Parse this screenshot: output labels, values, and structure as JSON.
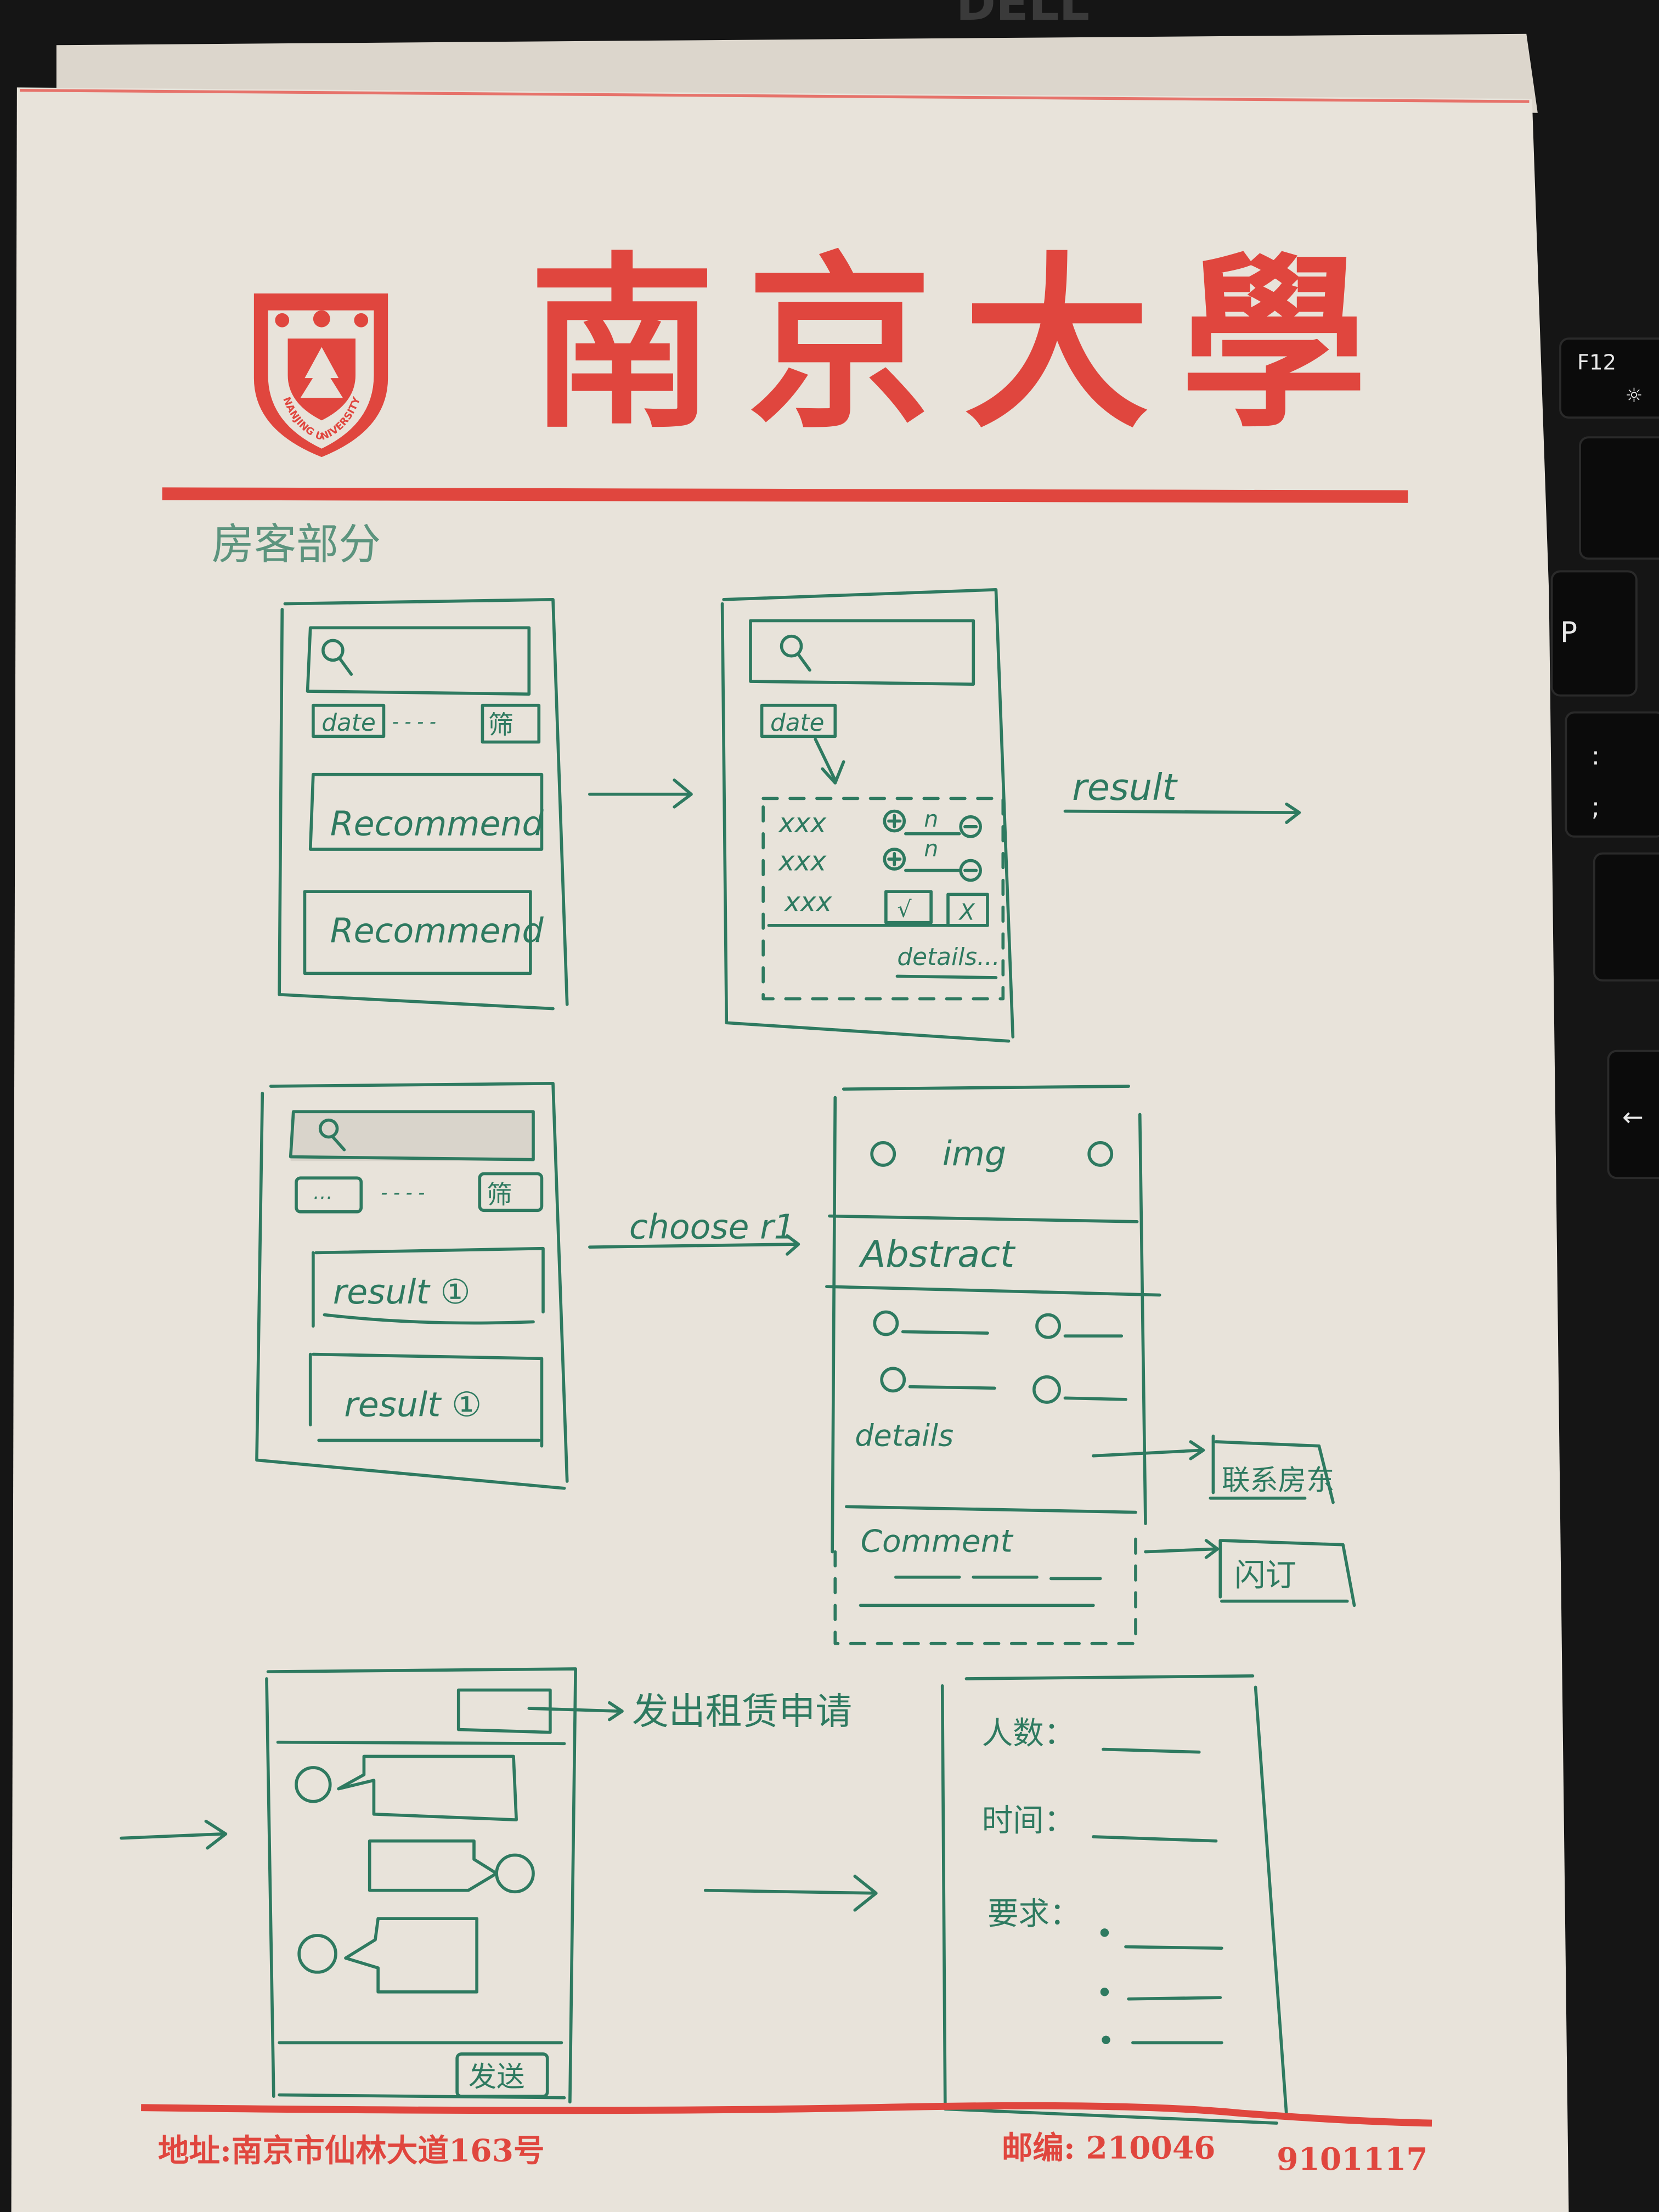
{
  "laptop": {
    "logo": "DELL",
    "keys": [
      "F12",
      "P",
      ":",
      ";",
      "←"
    ]
  },
  "letterhead": {
    "university_name": "南京大學",
    "emblem_text": "NANJING UNIVERSITY",
    "address": "地址:南京市仙林大道163号",
    "postcode": "邮编: 210046",
    "code": "9101117",
    "accent_color": "#e0463e"
  },
  "sketch": {
    "ink_color": "#2e7a60",
    "section_label": "房客部分",
    "screen_home": {
      "search_icon": "magnifier-icon",
      "date_chip": "date",
      "chip_dots": "- - - -",
      "filter_chip": "筛",
      "cards": [
        "Recommend",
        "Recommend"
      ]
    },
    "screen_filter": {
      "search_icon": "magnifier-icon",
      "date_chip": "date",
      "rows": [
        {
          "label": "xxx",
          "value": "n",
          "control": "stepper"
        },
        {
          "label": "xxx",
          "value": "n",
          "control": "stepper"
        },
        {
          "label": "xxx",
          "control": "confirm-cancel",
          "confirm": "√",
          "cancel": "X"
        }
      ],
      "details": "details..."
    },
    "result_label": "result",
    "screen_results": {
      "search_icon": "magnifier-icon",
      "chip_placeholder": "…",
      "chip_dots": "- - - -",
      "filter_chip": "筛",
      "cards": [
        "result ①",
        "result ①"
      ]
    },
    "choose_label": "choose r1",
    "screen_detail": {
      "image": "img",
      "abstract": "Abstract",
      "details": "details",
      "comment": "Comment"
    },
    "contact_button": "联系房东",
    "instant_book_button": "闪订",
    "screen_chat": {
      "send_button": "发送"
    },
    "lease_label": "发出租赁申请",
    "screen_form": {
      "fields": [
        "人数：",
        "时间：",
        "要求："
      ]
    }
  }
}
